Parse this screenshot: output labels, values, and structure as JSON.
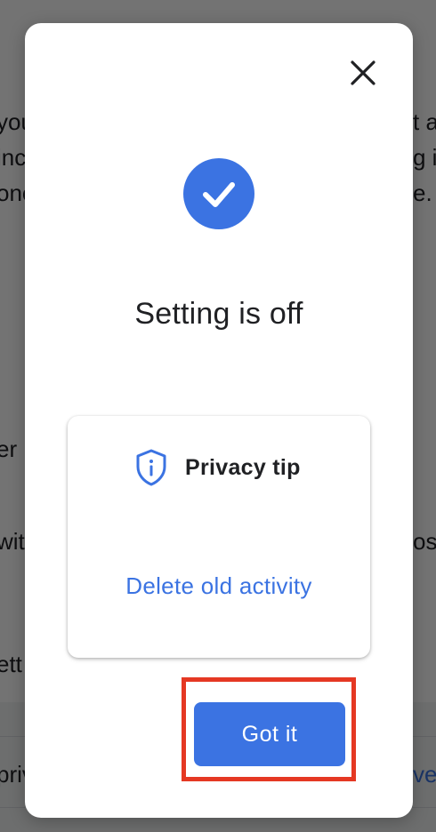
{
  "background": {
    "fragments": [
      {
        "text": "you",
        "side": "left",
        "row": 0
      },
      {
        "text": "inc",
        "side": "left",
        "row": 1
      },
      {
        "text": "one",
        "side": "left",
        "row": 2
      },
      {
        "text": "er",
        "side": "left",
        "row": 3
      },
      {
        "text": "wit",
        "side": "left",
        "row": 4
      },
      {
        "text": "ett",
        "side": "left",
        "row": 5
      },
      {
        "text": "priv",
        "side": "left",
        "row": 6
      },
      {
        "text": "t a",
        "side": "right",
        "row": 0
      },
      {
        "text": "g i",
        "side": "right",
        "row": 1
      },
      {
        "text": "e.",
        "side": "right",
        "row": 2
      },
      {
        "text": "os",
        "side": "right",
        "row": 4
      },
      {
        "text": "ve",
        "side": "right",
        "row": 6
      }
    ]
  },
  "dialog": {
    "close_icon": "close-icon",
    "status_icon": "check-circle-icon",
    "title": "Setting is off",
    "tip": {
      "icon": "shield-info-icon",
      "label": "Privacy tip",
      "link": "Delete old activity"
    },
    "primary_button": "Got it"
  },
  "colors": {
    "accent": "#3b73e2",
    "highlight": "#e53823",
    "text": "#202124"
  }
}
